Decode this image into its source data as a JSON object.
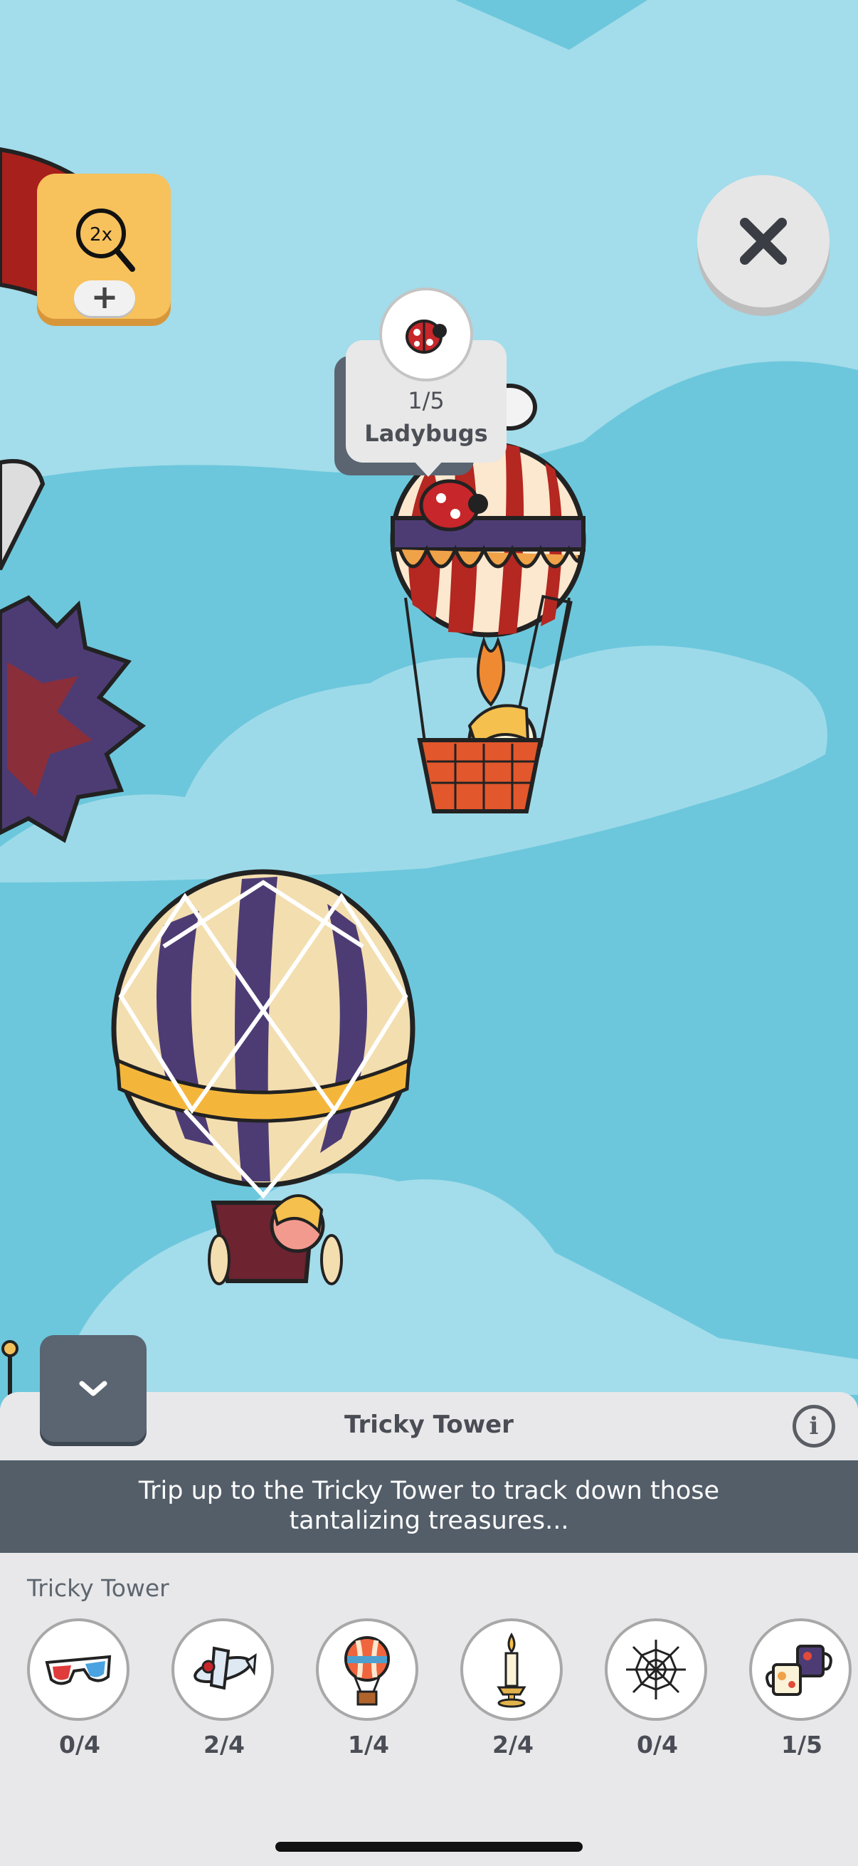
{
  "zoom": {
    "level_label": "2x",
    "icon": "magnifier-icon",
    "plus_label": "+"
  },
  "close": {
    "icon": "close-icon"
  },
  "tooltip": {
    "icon": "ladybug-icon",
    "count": "1/5",
    "label": "Ladybugs"
  },
  "panel": {
    "collapse_icon": "chevron-down-icon",
    "title": "Tricky Tower",
    "info_label": "i",
    "description_line1": "Trip up to the Tricky Tower to track down those",
    "description_line2": "tantalizing treasures...",
    "section_label": "Tricky Tower",
    "items": [
      {
        "icon": "3d-glasses-icon",
        "count": "0/4"
      },
      {
        "icon": "airplane-icon",
        "count": "2/4"
      },
      {
        "icon": "hot-air-balloon-icon",
        "count": "1/4"
      },
      {
        "icon": "candle-icon",
        "count": "2/4"
      },
      {
        "icon": "spiderweb-icon",
        "count": "0/4"
      },
      {
        "icon": "mugs-icon",
        "count": "1/5"
      }
    ]
  },
  "colors": {
    "sky": "#6cc7dc",
    "sky_light": "#a3dcea",
    "accent": "#f7c15c",
    "dark_panel": "#535e69"
  }
}
